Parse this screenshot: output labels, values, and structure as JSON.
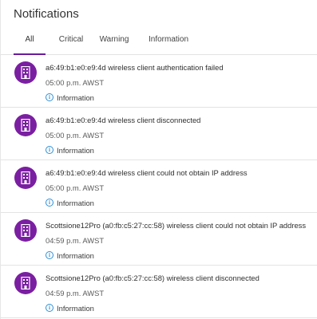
{
  "header": {
    "title": "Notifications"
  },
  "tabs": [
    {
      "label": "All"
    },
    {
      "label": "Critical"
    },
    {
      "label": "Warning"
    },
    {
      "label": "Information"
    }
  ],
  "notifications": [
    {
      "message": "a6:49:b1:e0:e9:4d wireless client authentication failed",
      "time": "05:00 p.m. AWST",
      "severity": "Information"
    },
    {
      "message": "a6:49:b1:e0:e9:4d wireless client disconnected",
      "time": "05:00 p.m. AWST",
      "severity": "Information"
    },
    {
      "message": "a6:49:b1:e0:e9:4d wireless client could not obtain IP address",
      "time": "05:00 p.m. AWST",
      "severity": "Information"
    },
    {
      "message": "Scottsione12Pro (a0:fb:c5:27:cc:58) wireless client could not obtain IP address",
      "time": "04:59 p.m. AWST",
      "severity": "Information"
    },
    {
      "message": "Scottsione12Pro (a0:fb:c5:27:cc:58) wireless client disconnected",
      "time": "04:59 p.m. AWST",
      "severity": "Information"
    }
  ],
  "colors": {
    "accent": "#7b1fa2",
    "info": "#2e8fd6",
    "divider": "#e3e3e3"
  },
  "icons": {
    "avatar": "building-icon",
    "severity": "info-icon"
  }
}
